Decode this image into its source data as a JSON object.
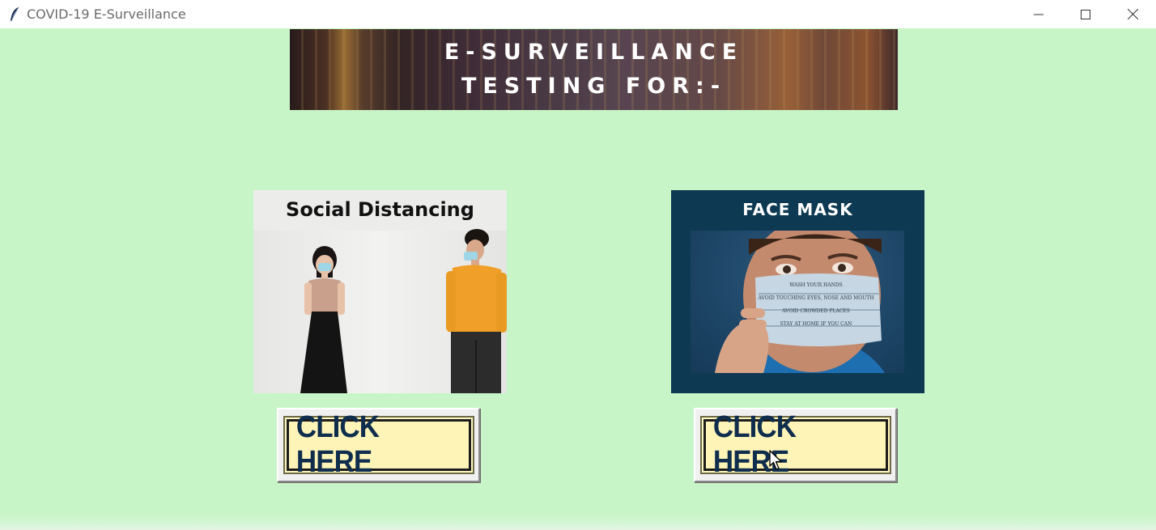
{
  "window": {
    "title": "COVID-19 E-Surveillance",
    "icons": {
      "app": "feather-icon",
      "minimize": "minimize-icon",
      "maximize": "maximize-icon",
      "close": "close-icon"
    }
  },
  "banner": {
    "line1": "E-SURVEILLANCE",
    "line2": "TESTING FOR:-"
  },
  "cards": {
    "social_distancing": {
      "title": "Social Distancing"
    },
    "face_mask": {
      "title": "FACE MASK",
      "mask_text": [
        "WASH YOUR HANDS",
        "AVOID TOUCHING EYES, NOSE AND MOUTH",
        "AVOID CROWDED PLACES",
        "STAY AT HOME IF YOU CAN"
      ]
    }
  },
  "buttons": {
    "social_distancing_label": "CLICK HERE",
    "face_mask_label": "CLICK HERE"
  },
  "colors": {
    "background": "#c8f5c8",
    "button_text": "#0f2e4e",
    "button_fill": "#fff4b8",
    "face_mask_card": "#0d3a52"
  }
}
